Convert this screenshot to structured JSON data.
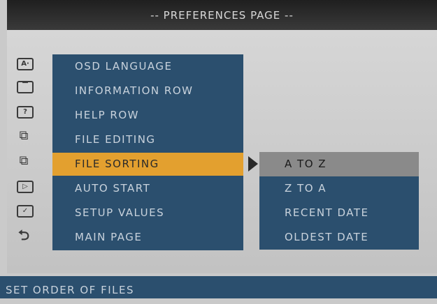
{
  "title": "-- PREFERENCES PAGE --",
  "menu": {
    "items": [
      {
        "label": "OSD LANGUAGE",
        "icon": "language-icon"
      },
      {
        "label": "INFORMATION ROW",
        "icon": "information-row-icon"
      },
      {
        "label": "HELP ROW",
        "icon": "help-row-icon"
      },
      {
        "label": "FILE EDITING",
        "icon": "file-editing-icon"
      },
      {
        "label": "FILE SORTING",
        "icon": "file-sorting-icon"
      },
      {
        "label": "AUTO START",
        "icon": "auto-start-icon"
      },
      {
        "label": "SETUP VALUES",
        "icon": "setup-values-icon"
      },
      {
        "label": "MAIN PAGE",
        "icon": "back-arrow-icon"
      }
    ],
    "selected_index": 4
  },
  "submenu": {
    "items": [
      {
        "label": "A TO Z"
      },
      {
        "label": "Z TO A"
      },
      {
        "label": "RECENT DATE"
      },
      {
        "label": "OLDEST DATE"
      }
    ],
    "selected_index": 0
  },
  "status": {
    "text": "SET ORDER OF FILES"
  },
  "colors": {
    "panel_blue": "#2b4f6e",
    "highlight_orange": "#e3a02f",
    "submenu_highlight_gray": "#8a8a8a",
    "titlebar_dark": "#2a2a2a",
    "background_gray": "#cacaca"
  }
}
